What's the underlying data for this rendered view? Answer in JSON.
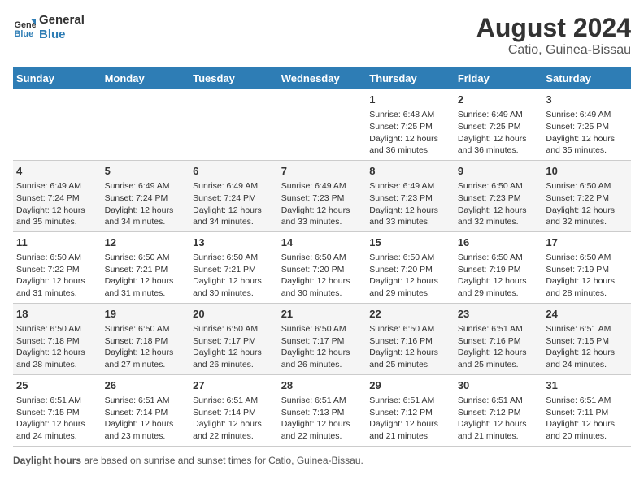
{
  "logo": {
    "line1": "General",
    "line2": "Blue"
  },
  "title": "August 2024",
  "subtitle": "Catio, Guinea-Bissau",
  "days_of_week": [
    "Sunday",
    "Monday",
    "Tuesday",
    "Wednesday",
    "Thursday",
    "Friday",
    "Saturday"
  ],
  "weeks": [
    [
      {
        "num": "",
        "info": ""
      },
      {
        "num": "",
        "info": ""
      },
      {
        "num": "",
        "info": ""
      },
      {
        "num": "",
        "info": ""
      },
      {
        "num": "1",
        "info": "Sunrise: 6:48 AM\nSunset: 7:25 PM\nDaylight: 12 hours and 36 minutes."
      },
      {
        "num": "2",
        "info": "Sunrise: 6:49 AM\nSunset: 7:25 PM\nDaylight: 12 hours and 36 minutes."
      },
      {
        "num": "3",
        "info": "Sunrise: 6:49 AM\nSunset: 7:25 PM\nDaylight: 12 hours and 35 minutes."
      }
    ],
    [
      {
        "num": "4",
        "info": "Sunrise: 6:49 AM\nSunset: 7:24 PM\nDaylight: 12 hours and 35 minutes."
      },
      {
        "num": "5",
        "info": "Sunrise: 6:49 AM\nSunset: 7:24 PM\nDaylight: 12 hours and 34 minutes."
      },
      {
        "num": "6",
        "info": "Sunrise: 6:49 AM\nSunset: 7:24 PM\nDaylight: 12 hours and 34 minutes."
      },
      {
        "num": "7",
        "info": "Sunrise: 6:49 AM\nSunset: 7:23 PM\nDaylight: 12 hours and 33 minutes."
      },
      {
        "num": "8",
        "info": "Sunrise: 6:49 AM\nSunset: 7:23 PM\nDaylight: 12 hours and 33 minutes."
      },
      {
        "num": "9",
        "info": "Sunrise: 6:50 AM\nSunset: 7:23 PM\nDaylight: 12 hours and 32 minutes."
      },
      {
        "num": "10",
        "info": "Sunrise: 6:50 AM\nSunset: 7:22 PM\nDaylight: 12 hours and 32 minutes."
      }
    ],
    [
      {
        "num": "11",
        "info": "Sunrise: 6:50 AM\nSunset: 7:22 PM\nDaylight: 12 hours and 31 minutes."
      },
      {
        "num": "12",
        "info": "Sunrise: 6:50 AM\nSunset: 7:21 PM\nDaylight: 12 hours and 31 minutes."
      },
      {
        "num": "13",
        "info": "Sunrise: 6:50 AM\nSunset: 7:21 PM\nDaylight: 12 hours and 30 minutes."
      },
      {
        "num": "14",
        "info": "Sunrise: 6:50 AM\nSunset: 7:20 PM\nDaylight: 12 hours and 30 minutes."
      },
      {
        "num": "15",
        "info": "Sunrise: 6:50 AM\nSunset: 7:20 PM\nDaylight: 12 hours and 29 minutes."
      },
      {
        "num": "16",
        "info": "Sunrise: 6:50 AM\nSunset: 7:19 PM\nDaylight: 12 hours and 29 minutes."
      },
      {
        "num": "17",
        "info": "Sunrise: 6:50 AM\nSunset: 7:19 PM\nDaylight: 12 hours and 28 minutes."
      }
    ],
    [
      {
        "num": "18",
        "info": "Sunrise: 6:50 AM\nSunset: 7:18 PM\nDaylight: 12 hours and 28 minutes."
      },
      {
        "num": "19",
        "info": "Sunrise: 6:50 AM\nSunset: 7:18 PM\nDaylight: 12 hours and 27 minutes."
      },
      {
        "num": "20",
        "info": "Sunrise: 6:50 AM\nSunset: 7:17 PM\nDaylight: 12 hours and 26 minutes."
      },
      {
        "num": "21",
        "info": "Sunrise: 6:50 AM\nSunset: 7:17 PM\nDaylight: 12 hours and 26 minutes."
      },
      {
        "num": "22",
        "info": "Sunrise: 6:50 AM\nSunset: 7:16 PM\nDaylight: 12 hours and 25 minutes."
      },
      {
        "num": "23",
        "info": "Sunrise: 6:51 AM\nSunset: 7:16 PM\nDaylight: 12 hours and 25 minutes."
      },
      {
        "num": "24",
        "info": "Sunrise: 6:51 AM\nSunset: 7:15 PM\nDaylight: 12 hours and 24 minutes."
      }
    ],
    [
      {
        "num": "25",
        "info": "Sunrise: 6:51 AM\nSunset: 7:15 PM\nDaylight: 12 hours and 24 minutes."
      },
      {
        "num": "26",
        "info": "Sunrise: 6:51 AM\nSunset: 7:14 PM\nDaylight: 12 hours and 23 minutes."
      },
      {
        "num": "27",
        "info": "Sunrise: 6:51 AM\nSunset: 7:14 PM\nDaylight: 12 hours and 22 minutes."
      },
      {
        "num": "28",
        "info": "Sunrise: 6:51 AM\nSunset: 7:13 PM\nDaylight: 12 hours and 22 minutes."
      },
      {
        "num": "29",
        "info": "Sunrise: 6:51 AM\nSunset: 7:12 PM\nDaylight: 12 hours and 21 minutes."
      },
      {
        "num": "30",
        "info": "Sunrise: 6:51 AM\nSunset: 7:12 PM\nDaylight: 12 hours and 21 minutes."
      },
      {
        "num": "31",
        "info": "Sunrise: 6:51 AM\nSunset: 7:11 PM\nDaylight: 12 hours and 20 minutes."
      }
    ]
  ],
  "footer": {
    "label": "Daylight hours",
    "text": " are based on sunrise and sunset times for Catio, Guinea-Bissau."
  }
}
